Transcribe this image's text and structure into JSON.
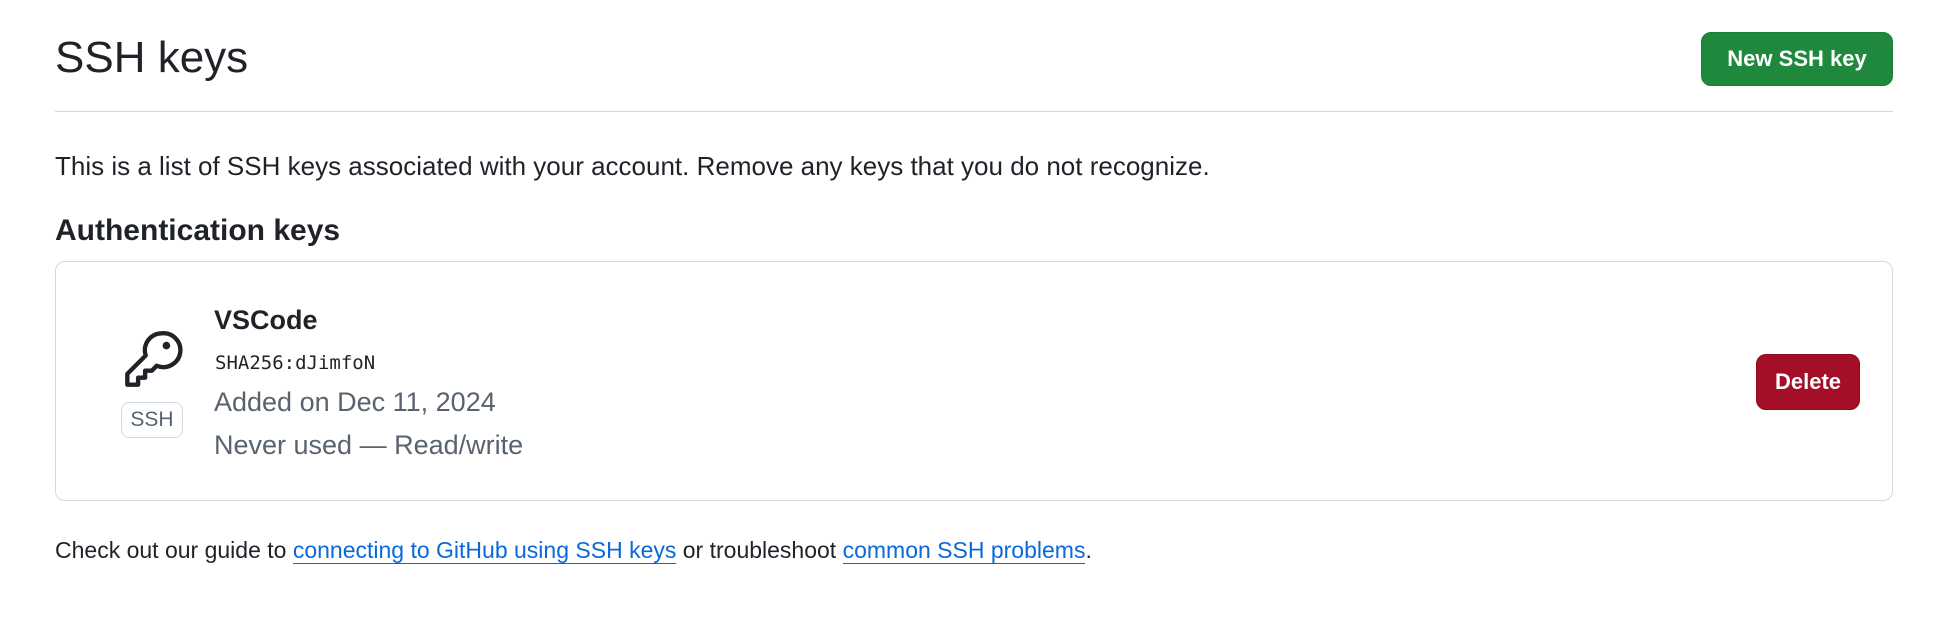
{
  "header": {
    "title": "SSH keys",
    "new_key_label": "New SSH key"
  },
  "description": "This is a list of SSH keys associated with your account. Remove any keys that you do not recognize.",
  "authentication_keys": {
    "section_title": "Authentication keys",
    "keys": [
      {
        "icon": "key-icon",
        "type_badge": "SSH",
        "title": "VSCode",
        "fingerprint": "SHA256:dJimfoN",
        "added": "Added on Dec 11, 2024",
        "usage": "Never used — Read/write",
        "delete_label": "Delete"
      }
    ]
  },
  "footer": {
    "text_before": "Check out our guide to ",
    "link1": "connecting to GitHub using SSH keys",
    "text_middle": " or troubleshoot ",
    "link2": "common SSH problems",
    "text_after": "."
  },
  "colors": {
    "primary_button": "#1f883d",
    "danger_button": "#a40e26",
    "link": "#0969da",
    "muted_text": "#59636e",
    "border": "#d1d9e0"
  }
}
